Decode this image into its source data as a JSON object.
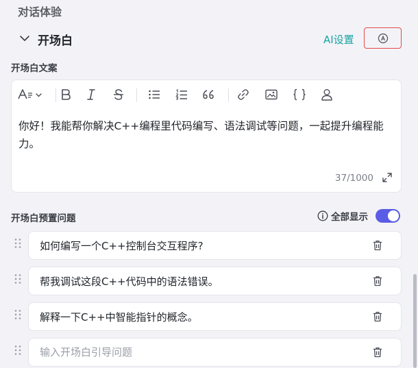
{
  "section_title": "对话体验",
  "opening": {
    "title": "开场白",
    "ai_settings_label": "AI设置",
    "copy_label": "开场白文案",
    "editor_text": "你好！我能帮你解决C++编程里代码编写、语法调试等问题，一起提升编程能力。",
    "counter": "37/1000",
    "toolbar": [
      "text-style",
      "bold",
      "italic",
      "strikethrough",
      "bullet-list",
      "numbered-list",
      "quote",
      "link",
      "image",
      "code",
      "mention"
    ]
  },
  "preset": {
    "label": "开场白预置问题",
    "show_all_label": "全部显示",
    "show_all_enabled": true,
    "questions": [
      "如何编写一个C++控制台交互程序?",
      "帮我调试这段C++代码中的语法错误。",
      "解释一下C++中智能指针的概念。"
    ],
    "input_placeholder": "输入开场白引导问题"
  },
  "accent_color": "#5b5ce6",
  "link_color": "#16a3a3",
  "highlight_color": "#e24a4a"
}
